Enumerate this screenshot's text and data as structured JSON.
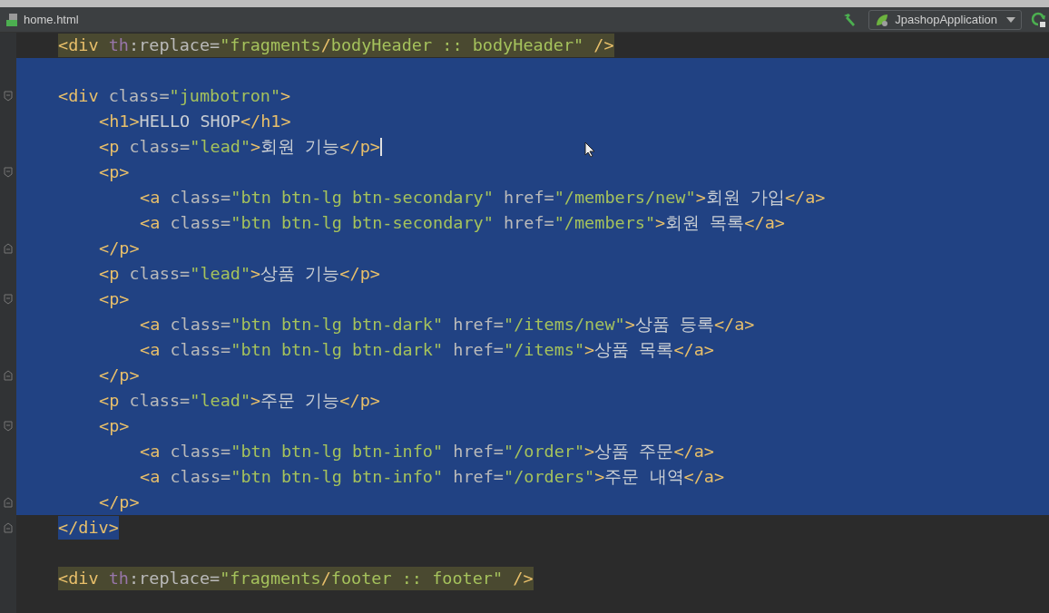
{
  "window": {
    "title_bar": true
  },
  "toolbar": {
    "file_tab": "home.html",
    "run_configuration": "JpashopApplication"
  },
  "editor": {
    "lines": [
      {
        "kind": "code",
        "highlighted": true,
        "selected": false,
        "tokens": [
          {
            "kind": "tag",
            "text": "<div "
          },
          {
            "kind": "ns",
            "text": "th"
          },
          {
            "kind": "attr",
            "text": ":replace="
          },
          {
            "kind": "str",
            "text": "\"fragments"
          },
          {
            "kind": "tag",
            "text": "/"
          },
          {
            "kind": "str",
            "text": "bodyHeader :: bodyHeader\""
          },
          {
            "kind": "tag",
            "text": " />"
          }
        ]
      },
      {
        "kind": "blank",
        "selected": true
      },
      {
        "kind": "code",
        "highlighted": false,
        "selected": true,
        "tokens": [
          {
            "kind": "tag",
            "text": "<div "
          },
          {
            "kind": "attr",
            "text": "class="
          },
          {
            "kind": "str",
            "text": "\"jumbotron\""
          },
          {
            "kind": "tag",
            "text": ">"
          }
        ],
        "children": [
          {
            "kind": "code",
            "selected": true,
            "tokens": [
              {
                "kind": "tag",
                "text": "<h1>"
              },
              {
                "kind": "text",
                "text": "HELLO SHOP"
              },
              {
                "kind": "tag",
                "text": "</h1>"
              }
            ]
          },
          {
            "kind": "code",
            "selected": true,
            "caret": true,
            "tokens": [
              {
                "kind": "tag",
                "text": "<p "
              },
              {
                "kind": "attr",
                "text": "class="
              },
              {
                "kind": "str",
                "text": "\"lead\""
              },
              {
                "kind": "tag",
                "text": ">"
              },
              {
                "kind": "text",
                "text": "회원 기능"
              },
              {
                "kind": "tag",
                "text": "</p>"
              }
            ]
          },
          {
            "kind": "code",
            "selected": true,
            "tokens": [
              {
                "kind": "tag",
                "text": "<p>"
              }
            ],
            "children": [
              {
                "kind": "code",
                "selected": true,
                "tokens": [
                  {
                    "kind": "tag",
                    "text": "<a "
                  },
                  {
                    "kind": "attr",
                    "text": "class="
                  },
                  {
                    "kind": "str",
                    "text": "\"btn btn-lg btn-secondary\" "
                  },
                  {
                    "kind": "attr",
                    "text": "href="
                  },
                  {
                    "kind": "str",
                    "text": "\"/members/new\""
                  },
                  {
                    "kind": "tag",
                    "text": ">"
                  },
                  {
                    "kind": "text",
                    "text": "회원 가입"
                  },
                  {
                    "kind": "tag",
                    "text": "</a>"
                  }
                ]
              },
              {
                "kind": "code",
                "selected": true,
                "tokens": [
                  {
                    "kind": "tag",
                    "text": "<a "
                  },
                  {
                    "kind": "attr",
                    "text": "class="
                  },
                  {
                    "kind": "str",
                    "text": "\"btn btn-lg btn-secondary\" "
                  },
                  {
                    "kind": "attr",
                    "text": "href="
                  },
                  {
                    "kind": "str",
                    "text": "\"/members\""
                  },
                  {
                    "kind": "tag",
                    "text": ">"
                  },
                  {
                    "kind": "text",
                    "text": "회원 목록"
                  },
                  {
                    "kind": "tag",
                    "text": "</a>"
                  }
                ]
              }
            ],
            "close": {
              "selected": true,
              "tokens": [
                {
                  "kind": "tag",
                  "text": "</p>"
                }
              ]
            }
          },
          {
            "kind": "code",
            "selected": true,
            "tokens": [
              {
                "kind": "tag",
                "text": "<p "
              },
              {
                "kind": "attr",
                "text": "class="
              },
              {
                "kind": "str",
                "text": "\"lead\""
              },
              {
                "kind": "tag",
                "text": ">"
              },
              {
                "kind": "text",
                "text": "상품 기능"
              },
              {
                "kind": "tag",
                "text": "</p>"
              }
            ]
          },
          {
            "kind": "code",
            "selected": true,
            "tokens": [
              {
                "kind": "tag",
                "text": "<p>"
              }
            ],
            "children": [
              {
                "kind": "code",
                "selected": true,
                "tokens": [
                  {
                    "kind": "tag",
                    "text": "<a "
                  },
                  {
                    "kind": "attr",
                    "text": "class="
                  },
                  {
                    "kind": "str",
                    "text": "\"btn btn-lg btn-dark\" "
                  },
                  {
                    "kind": "attr",
                    "text": "href="
                  },
                  {
                    "kind": "str",
                    "text": "\"/items/new\""
                  },
                  {
                    "kind": "tag",
                    "text": ">"
                  },
                  {
                    "kind": "text",
                    "text": "상품 등록"
                  },
                  {
                    "kind": "tag",
                    "text": "</a>"
                  }
                ]
              },
              {
                "kind": "code",
                "selected": true,
                "tokens": [
                  {
                    "kind": "tag",
                    "text": "<a "
                  },
                  {
                    "kind": "attr",
                    "text": "class="
                  },
                  {
                    "kind": "str",
                    "text": "\"btn btn-lg btn-dark\" "
                  },
                  {
                    "kind": "attr",
                    "text": "href="
                  },
                  {
                    "kind": "str",
                    "text": "\"/items\""
                  },
                  {
                    "kind": "tag",
                    "text": ">"
                  },
                  {
                    "kind": "text",
                    "text": "상품 목록"
                  },
                  {
                    "kind": "tag",
                    "text": "</a>"
                  }
                ]
              }
            ],
            "close": {
              "selected": true,
              "tokens": [
                {
                  "kind": "tag",
                  "text": "</p>"
                }
              ]
            }
          },
          {
            "kind": "code",
            "selected": true,
            "tokens": [
              {
                "kind": "tag",
                "text": "<p "
              },
              {
                "kind": "attr",
                "text": "class="
              },
              {
                "kind": "str",
                "text": "\"lead\""
              },
              {
                "kind": "tag",
                "text": ">"
              },
              {
                "kind": "text",
                "text": "주문 기능"
              },
              {
                "kind": "tag",
                "text": "</p>"
              }
            ]
          },
          {
            "kind": "code",
            "selected": true,
            "tokens": [
              {
                "kind": "tag",
                "text": "<p>"
              }
            ],
            "children": [
              {
                "kind": "code",
                "selected": true,
                "tokens": [
                  {
                    "kind": "tag",
                    "text": "<a "
                  },
                  {
                    "kind": "attr",
                    "text": "class="
                  },
                  {
                    "kind": "str",
                    "text": "\"btn btn-lg btn-info\" "
                  },
                  {
                    "kind": "attr",
                    "text": "href="
                  },
                  {
                    "kind": "str",
                    "text": "\"/order\""
                  },
                  {
                    "kind": "tag",
                    "text": ">"
                  },
                  {
                    "kind": "text",
                    "text": "상품 주문"
                  },
                  {
                    "kind": "tag",
                    "text": "</a>"
                  }
                ]
              },
              {
                "kind": "code",
                "selected": true,
                "tokens": [
                  {
                    "kind": "tag",
                    "text": "<a "
                  },
                  {
                    "kind": "attr",
                    "text": "class="
                  },
                  {
                    "kind": "str",
                    "text": "\"btn btn-lg btn-info\" "
                  },
                  {
                    "kind": "attr",
                    "text": "href="
                  },
                  {
                    "kind": "str",
                    "text": "\"/orders\""
                  },
                  {
                    "kind": "tag",
                    "text": ">"
                  },
                  {
                    "kind": "text",
                    "text": "주문 내역"
                  },
                  {
                    "kind": "tag",
                    "text": "</a>"
                  }
                ]
              }
            ],
            "close": {
              "selected": true,
              "tokens": [
                {
                  "kind": "tag",
                  "text": "</p>"
                }
              ]
            }
          }
        ],
        "close": {
          "selected": true,
          "tokens": [
            {
              "kind": "tag",
              "text": "</div>"
            }
          ]
        }
      },
      {
        "kind": "blank",
        "selected": false
      },
      {
        "kind": "code",
        "highlighted": true,
        "selected": false,
        "tokens": [
          {
            "kind": "tag",
            "text": "<div "
          },
          {
            "kind": "ns",
            "text": "th"
          },
          {
            "kind": "attr",
            "text": ":replace="
          },
          {
            "kind": "str",
            "text": "\"fragments"
          },
          {
            "kind": "tag",
            "text": "/"
          },
          {
            "kind": "str",
            "text": "footer :: footer\""
          },
          {
            "kind": "tag",
            "text": " />"
          }
        ]
      }
    ]
  }
}
